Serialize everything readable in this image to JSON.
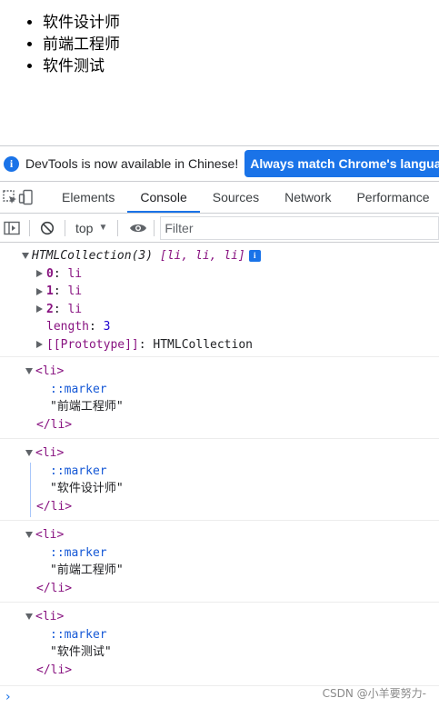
{
  "page": {
    "list_items": [
      "软件设计师",
      "前端工程师",
      "软件测试"
    ]
  },
  "infobar": {
    "text": "DevTools is now available in Chinese!",
    "button_label": "Always match Chrome's language"
  },
  "tabs": [
    {
      "label": "Elements",
      "active": false
    },
    {
      "label": "Console",
      "active": true
    },
    {
      "label": "Sources",
      "active": false
    },
    {
      "label": "Network",
      "active": false
    },
    {
      "label": "Performance",
      "active": false
    }
  ],
  "console_toolbar": {
    "context": "top",
    "filter_placeholder": "Filter"
  },
  "collection": {
    "summary_name": "HTMLCollection(3)",
    "summary_items": "[li, li, li]",
    "entries": [
      {
        "key": "0",
        "value": "li"
      },
      {
        "key": "1",
        "value": "li"
      },
      {
        "key": "2",
        "value": "li"
      }
    ],
    "length_key": "length",
    "length_value": "3",
    "prototype_key": "[[Prototype]]",
    "prototype_value": "HTMLCollection"
  },
  "logged_elements": [
    {
      "open_tag": "<li>",
      "pseudo": "::marker",
      "text": "\"前端工程师\"",
      "close_tag": "</li>"
    },
    {
      "open_tag": "<li>",
      "pseudo": "::marker",
      "text": "\"软件设计师\"",
      "close_tag": "</li>"
    },
    {
      "open_tag": "<li>",
      "pseudo": "::marker",
      "text": "\"前端工程师\"",
      "close_tag": "</li>"
    },
    {
      "open_tag": "<li>",
      "pseudo": "::marker",
      "text": "\"软件测试\"",
      "close_tag": "</li>"
    }
  ],
  "watermark": "CSDN @小羊要努力-",
  "colors": {
    "accent": "#1a73e8",
    "property_key": "#881280",
    "number": "#1c00cf"
  },
  "icons": {
    "info": "info-circle-icon",
    "inspect": "inspect-element-icon",
    "device": "device-toolbar-icon",
    "sidebar": "console-sidebar-icon",
    "clear": "clear-console-icon",
    "eye": "live-expression-eye-icon",
    "prompt": "console-prompt-chevron-icon"
  }
}
